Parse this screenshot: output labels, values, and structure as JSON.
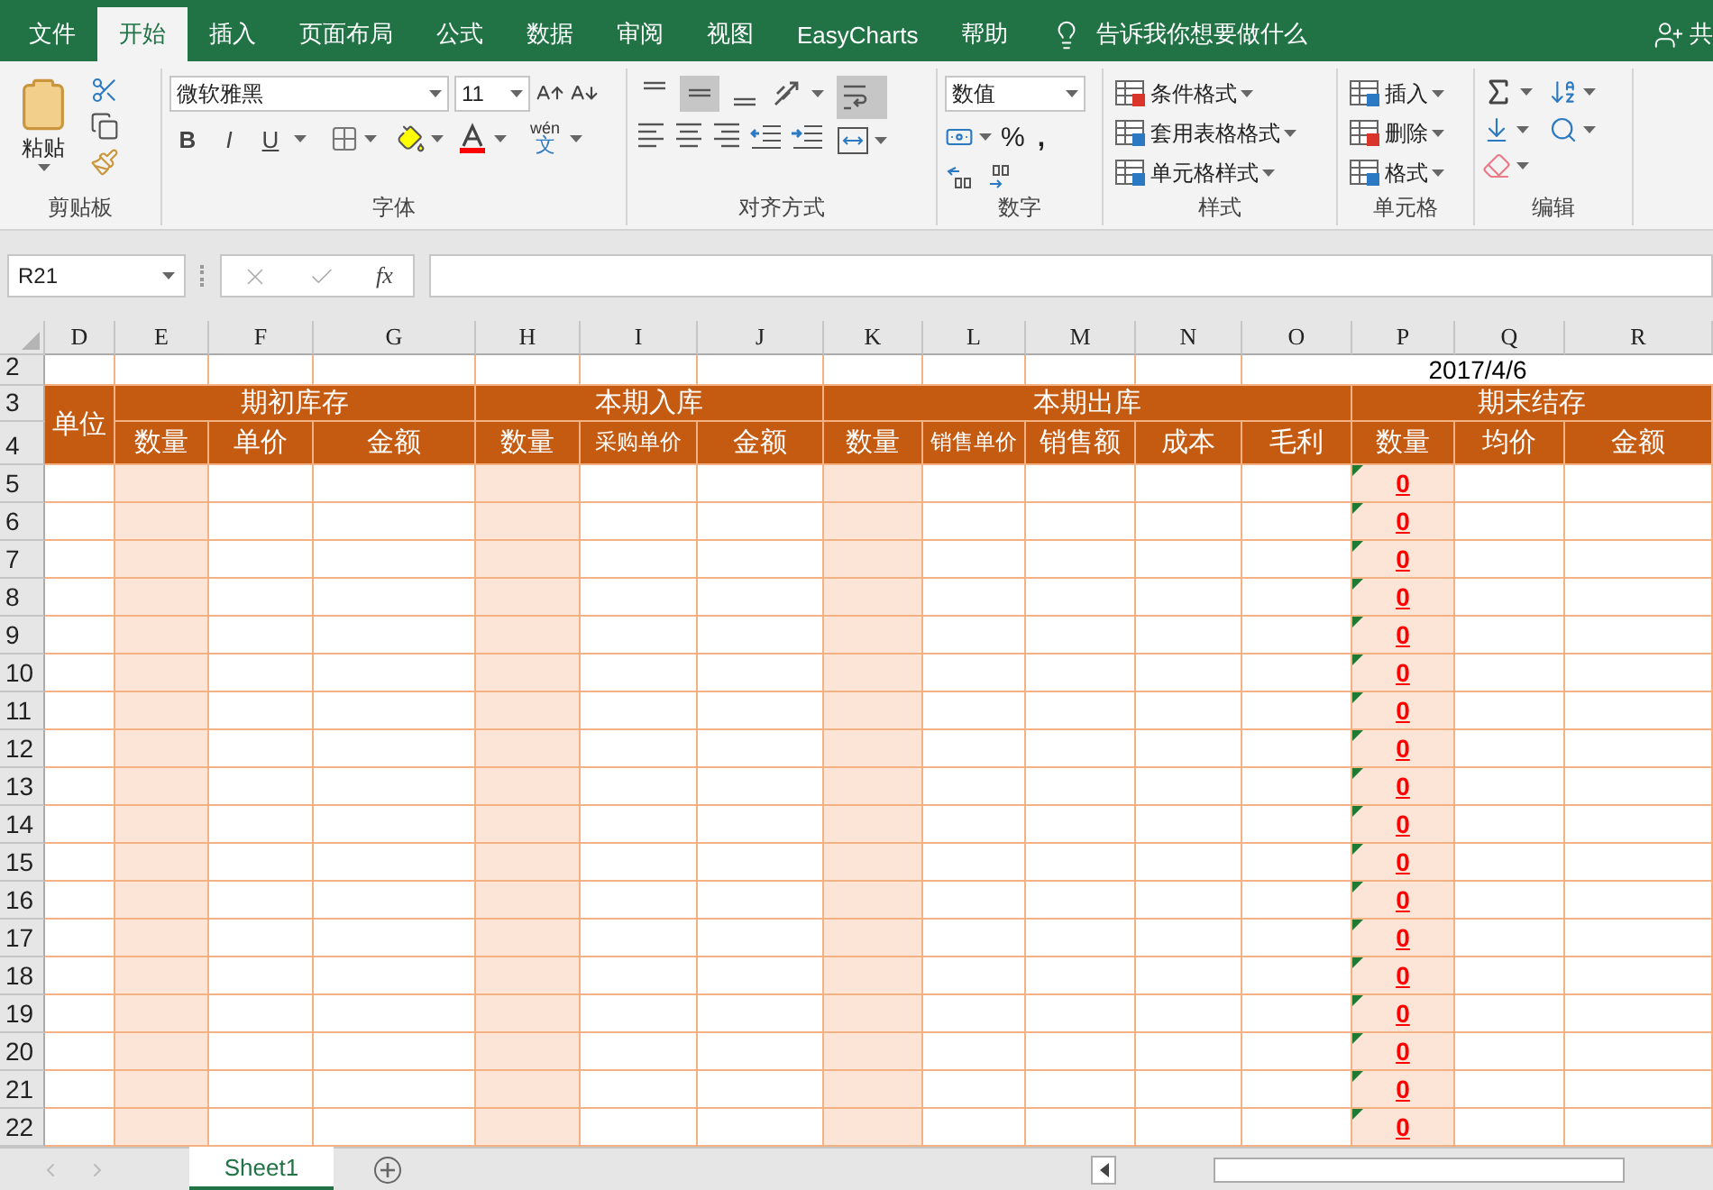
{
  "tabs": [
    {
      "label": "文件",
      "selected": false
    },
    {
      "label": "开始",
      "selected": true
    },
    {
      "label": "插入",
      "selected": false
    },
    {
      "label": "页面布局",
      "selected": false
    },
    {
      "label": "公式",
      "selected": false
    },
    {
      "label": "数据",
      "selected": false
    },
    {
      "label": "审阅",
      "selected": false
    },
    {
      "label": "视图",
      "selected": false
    },
    {
      "label": "EasyCharts",
      "selected": false
    },
    {
      "label": "帮助",
      "selected": false
    }
  ],
  "tell_me": "告诉我你想要做什么",
  "share": "共",
  "clipboard": {
    "paste": "粘贴",
    "label": "剪贴板"
  },
  "font": {
    "name": "微软雅黑",
    "size": "11",
    "bold": "B",
    "italic": "I",
    "underline": "U",
    "phonetic_top": "wén",
    "phonetic_bottom": "文",
    "label": "字体"
  },
  "alignment": {
    "vertical": [
      {
        "selected": false
      },
      {
        "selected": true
      },
      {
        "selected": false
      }
    ],
    "wrap_selected": true,
    "label": "对齐方式"
  },
  "number": {
    "format": "数值",
    "percent": "%",
    "comma": ",",
    "label": "数字"
  },
  "styles": {
    "items": [
      "条件格式",
      "套用表格格式",
      "单元格样式"
    ],
    "label": "样式"
  },
  "cells": {
    "items": [
      "插入",
      "删除",
      "格式"
    ],
    "label": "单元格"
  },
  "editing": {
    "label": "编辑"
  },
  "name_box": "R21",
  "function_label": "fx",
  "columns": [
    {
      "letter": "D",
      "shaded": false
    },
    {
      "letter": "E",
      "shaded": true
    },
    {
      "letter": "F",
      "shaded": false
    },
    {
      "letter": "G",
      "shaded": false
    },
    {
      "letter": "H",
      "shaded": true
    },
    {
      "letter": "I",
      "shaded": false
    },
    {
      "letter": "J",
      "shaded": false
    },
    {
      "letter": "K",
      "shaded": true
    },
    {
      "letter": "L",
      "shaded": false
    },
    {
      "letter": "M",
      "shaded": false
    },
    {
      "letter": "N",
      "shaded": false
    },
    {
      "letter": "O",
      "shaded": false
    },
    {
      "letter": "P",
      "shaded": true
    },
    {
      "letter": "Q",
      "shaded": false
    },
    {
      "letter": "R",
      "shaded": false
    }
  ],
  "date_row": {
    "number": "2",
    "value": "2017/4/6"
  },
  "header_rows": [
    "3",
    "4"
  ],
  "unit_label": "单位",
  "header_groups": [
    {
      "label": "期初库存",
      "columns": [
        "数量",
        "单价",
        "金额"
      ]
    },
    {
      "label": "本期入库",
      "columns": [
        "数量",
        "采购单价",
        "金额"
      ]
    },
    {
      "label": "本期出库",
      "columns": [
        "数量",
        "销售单价",
        "销售额",
        "成本",
        "毛利"
      ]
    },
    {
      "label": "期末结存",
      "columns": [
        "数量",
        "均价",
        "金额"
      ]
    }
  ],
  "rows": [
    {
      "number": "5",
      "value": "0",
      "flagged": true
    },
    {
      "number": "6",
      "value": "0",
      "flagged": true
    },
    {
      "number": "7",
      "value": "0",
      "flagged": true
    },
    {
      "number": "8",
      "value": "0",
      "flagged": true
    },
    {
      "number": "9",
      "value": "0",
      "flagged": true
    },
    {
      "number": "10",
      "value": "0",
      "flagged": true
    },
    {
      "number": "11",
      "value": "0",
      "flagged": true
    },
    {
      "number": "12",
      "value": "0",
      "flagged": true
    },
    {
      "number": "13",
      "value": "0",
      "flagged": true
    },
    {
      "number": "14",
      "value": "0",
      "flagged": true
    },
    {
      "number": "15",
      "value": "0",
      "flagged": true
    },
    {
      "number": "16",
      "value": "0",
      "flagged": true
    },
    {
      "number": "17",
      "value": "0",
      "flagged": true
    },
    {
      "number": "18",
      "value": "0",
      "flagged": true
    },
    {
      "number": "19",
      "value": "0",
      "flagged": true
    },
    {
      "number": "20",
      "value": "0",
      "flagged": true
    },
    {
      "number": "21",
      "value": "0",
      "flagged": true
    },
    {
      "number": "22",
      "value": "0",
      "flagged": true
    }
  ],
  "sheet_tabs": [
    {
      "label": "Sheet1",
      "selected": true
    }
  ]
}
